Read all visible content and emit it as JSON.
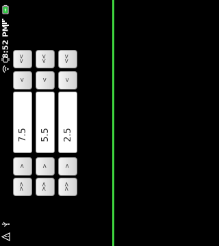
{
  "status_bar": {
    "time": "8:52 PM",
    "battery_icon": "battery-charging-icon",
    "signal_icon": "signal-bars-icon",
    "wifi_icon": "wifi-icon",
    "alarm_icon": "vibrate-icon",
    "usb_icon": "usb-icon",
    "warning_icon": "warning-icon"
  },
  "steppers": [
    {
      "big_up": "<<",
      "up": "<",
      "value": "7.5",
      "down": ">",
      "big_down": ">>"
    },
    {
      "big_up": "<<",
      "up": "<",
      "value": "5.5",
      "down": ">",
      "big_down": ">>"
    },
    {
      "big_up": "<<",
      "up": "<",
      "value": "2.5",
      "down": ">",
      "big_down": ">>"
    }
  ],
  "colors": {
    "background": "#000000",
    "line": "#3fd43f",
    "battery": "#2ecc40"
  }
}
